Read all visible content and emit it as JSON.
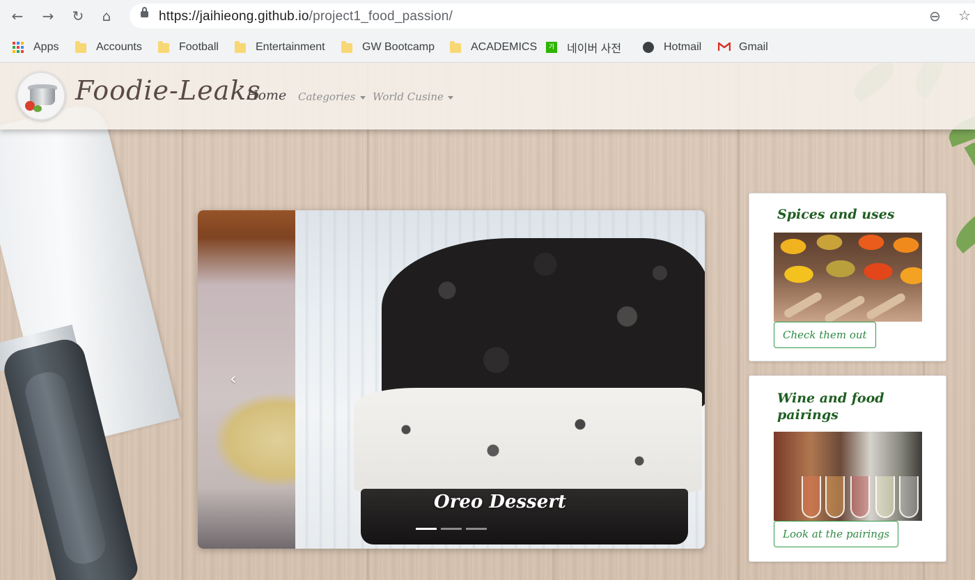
{
  "browser": {
    "url_host": "https://jaihieong.github.io",
    "url_path": "/project1_food_passion/",
    "back": "←",
    "forward": "→",
    "reload": "↻",
    "home": "⌂",
    "zoom": "⊖",
    "star": "☆",
    "bookmarks": [
      {
        "label": "Apps",
        "icon": "apps-grid-icon"
      },
      {
        "label": "Accounts",
        "icon": "folder-icon"
      },
      {
        "label": "Football",
        "icon": "folder-icon"
      },
      {
        "label": "Entertainment",
        "icon": "folder-icon"
      },
      {
        "label": "GW Bootcamp",
        "icon": "folder-icon"
      },
      {
        "label": "ACADEMICS",
        "icon": "folder-icon"
      },
      {
        "label": "네이버 사전",
        "icon": "naver-icon"
      },
      {
        "label": "Hotmail",
        "icon": "globe-icon"
      },
      {
        "label": "Gmail",
        "icon": "gmail-icon"
      }
    ],
    "naver_glyph": "가"
  },
  "navbar": {
    "brand": "Foodie-Leaks",
    "home": "Home",
    "categories": "Categories",
    "world_cuisine": "World Cusine"
  },
  "carousel": {
    "caption": "Oreo Dessert",
    "prev_arrow": "‹",
    "slide_count": 3,
    "active_index": 0
  },
  "cards": [
    {
      "title": "Spices and uses",
      "button": "Check them out",
      "image": "spices-photo"
    },
    {
      "title": "Wine and food pairings",
      "button": "Look at the pairings",
      "image": "wine-photo"
    }
  ],
  "colors": {
    "brand_text": "#5a4a45",
    "card_title": "#1f5e22",
    "card_button": "#2f8a43"
  }
}
